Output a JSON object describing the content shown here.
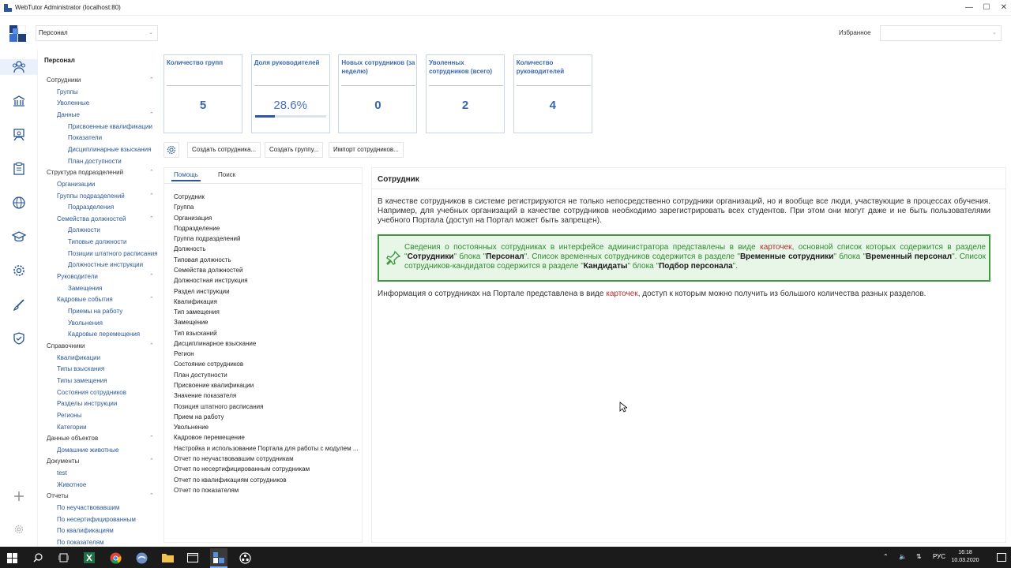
{
  "window": {
    "title": "WebTutor Administrator (localhost:80)",
    "min": "—",
    "max": "☐",
    "close": "✕"
  },
  "header": {
    "section_select": "Персонал",
    "favorites_label": "Избранное",
    "favorites_select": ""
  },
  "nav": {
    "title": "Персонал",
    "items": [
      {
        "label": "Сотрудники",
        "level": 0,
        "expanded": true
      },
      {
        "label": "Группы",
        "level": 1
      },
      {
        "label": "Уволенные",
        "level": 1
      },
      {
        "label": "Данные",
        "level": 1,
        "expanded": true
      },
      {
        "label": "Присвоенные квалификации",
        "level": 2
      },
      {
        "label": "Показатели",
        "level": 2
      },
      {
        "label": "Дисциплинарные взыскания",
        "level": 2
      },
      {
        "label": "План доступности",
        "level": 2
      },
      {
        "label": "Структура подразделений",
        "level": 0,
        "expanded": true
      },
      {
        "label": "Организации",
        "level": 1
      },
      {
        "label": "Группы подразделений",
        "level": 1,
        "expanded": true
      },
      {
        "label": "Подразделения",
        "level": 2
      },
      {
        "label": "Семейства должностей",
        "level": 1,
        "expanded": true
      },
      {
        "label": "Должности",
        "level": 2
      },
      {
        "label": "Типовые должности",
        "level": 2
      },
      {
        "label": "Позиции штатного расписания",
        "level": 2
      },
      {
        "label": "Должностные инструкции",
        "level": 2
      },
      {
        "label": "Руководители",
        "level": 1,
        "expanded": true
      },
      {
        "label": "Замещения",
        "level": 2
      },
      {
        "label": "Кадровые события",
        "level": 1,
        "expanded": true
      },
      {
        "label": "Приемы на работу",
        "level": 2
      },
      {
        "label": "Увольнения",
        "level": 2
      },
      {
        "label": "Кадровые перемещения",
        "level": 2
      },
      {
        "label": "Справочники",
        "level": 0,
        "expanded": true
      },
      {
        "label": "Квалификации",
        "level": 1
      },
      {
        "label": "Типы взыскания",
        "level": 1
      },
      {
        "label": "Типы замещения",
        "level": 1
      },
      {
        "label": "Состояния сотрудников",
        "level": 1
      },
      {
        "label": "Разделы инструкции",
        "level": 1
      },
      {
        "label": "Регионы",
        "level": 1
      },
      {
        "label": "Категории",
        "level": 1
      },
      {
        "label": "Данные объектов",
        "level": 0,
        "expanded": true
      },
      {
        "label": "Домашние животные",
        "level": 1
      },
      {
        "label": "Документы",
        "level": 0,
        "expanded": true
      },
      {
        "label": "test",
        "level": 1
      },
      {
        "label": "Животное",
        "level": 1
      },
      {
        "label": "Отчеты",
        "level": 0,
        "expanded": true
      },
      {
        "label": "По неучаствовавшим",
        "level": 1
      },
      {
        "label": "По несертифицированным",
        "level": 1
      },
      {
        "label": "По квалификациям",
        "level": 1
      },
      {
        "label": "По показателям",
        "level": 1
      }
    ]
  },
  "cards": [
    {
      "title": "Количество групп",
      "value": "5"
    },
    {
      "title": "Доля руководителей",
      "value": "28.6%",
      "progress": 0.286
    },
    {
      "title": "Новых сотрудников (за неделю)",
      "value": "0"
    },
    {
      "title": "Уволенных сотрудников (всего)",
      "value": "2"
    },
    {
      "title": "Количество руководителей",
      "value": "4"
    }
  ],
  "toolbar": {
    "create_employee": "Создать сотрудника...",
    "create_group": "Создать группу...",
    "import_employees": "Импорт сотрудников..."
  },
  "left_tabs": {
    "help": "Помощь",
    "search": "Поиск"
  },
  "help_items": [
    "Сотрудник",
    "Группа",
    "Организация",
    "Подразделение",
    "Группа подразделений",
    "Должность",
    "Типовая должность",
    "Семейства должностей",
    "Должностная инструкция",
    "Раздел инструкции",
    "Квалификация",
    "Тип замещения",
    "Замещение",
    "Тип взысканий",
    "Дисциплинарное взыскание",
    "Регион",
    "Состояние сотрудников",
    "План доступности",
    "Присвоение квалификации",
    "Значение показателя",
    "Позиция штатного расписания",
    "Прием на работу",
    "Увольнение",
    "Кадровое перемещение",
    "Настройка и использование Портала для работы с модулем ...",
    "Отчет по неучаствовавшим сотрудникам",
    "Отчет по несертифицированным сотрудникам",
    "Отчет по квалификациям сотрудников",
    "Отчет по показателям"
  ],
  "content": {
    "title": "Сотрудник",
    "p1": "В качестве сотрудников в системе регистрируются не только непосредственно сотрудники организаций, но и вообще все люди, участвующие в процессах обучения. Например, для учебных организаций в качестве сотрудников необходимо зарегистрировать всех студентов. При этом они могут даже и не быть пользователями учебного Портала (доступ на Портал может быть запрещен).",
    "note": {
      "t1": "Сведения о постоянных сотрудниках в интерфейсе администратора представлены в виде ",
      "link1": "карточек",
      "t2": ", основной список которых содержится в разделе \"",
      "b1": "Сотрудники",
      "t3": "\" блока \"",
      "b2": "Персонал",
      "t4": "\". Список временных сотрудников содержится в разделе \"",
      "b3": "Временные сотрудники",
      "t5": "\" блока \"",
      "b4": "Временный персонал",
      "t6": "\". Список сотрудников-кандидатов содержится в разделе \"",
      "b5": "Кандидаты",
      "t7": "\" блока \"",
      "b6": "Подбор персонала",
      "t8": "\"."
    },
    "p2_a": "Информация о сотрудниках на Портале представлена в виде ",
    "p2_link": "карточек",
    "p2_b": ", доступ к которым можно получить из большого количества разных разделов."
  },
  "taskbar": {
    "lang": "РУС",
    "time": "16:18",
    "date": "10.03.2020"
  },
  "colors": {
    "accent": "#2b5797",
    "card_title": "#3a66b0",
    "note_border": "#3f9a3f",
    "note_bg": "#e8f6e8",
    "note_text": "#2e8b2e",
    "link_red": "#b03030"
  }
}
